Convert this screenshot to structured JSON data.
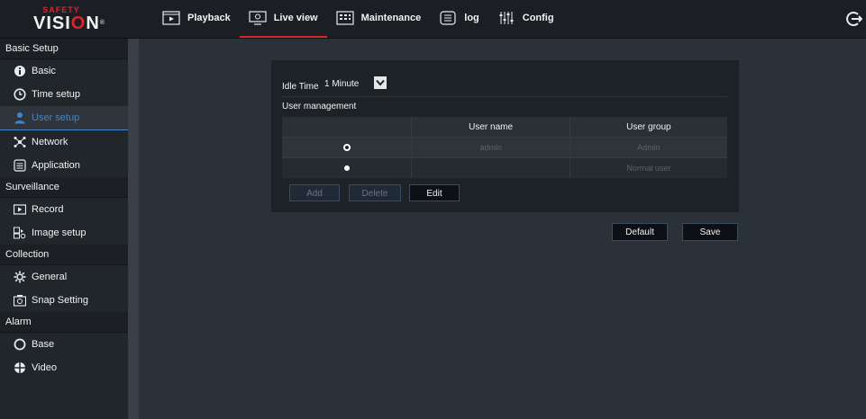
{
  "brand": {
    "top": "SAFETY",
    "main_pre": "VISI",
    "main_o": "O",
    "main_post": "N",
    "reg": "®"
  },
  "nav": {
    "items": [
      {
        "label": "Playback",
        "icon": "playback-icon"
      },
      {
        "label": "Live view",
        "icon": "live-view-icon",
        "active": true
      },
      {
        "label": "Maintenance",
        "icon": "maintenance-icon"
      },
      {
        "label": "log",
        "icon": "log-icon"
      },
      {
        "label": "Config",
        "icon": "config-icon"
      }
    ],
    "logout_icon": "logout-icon"
  },
  "sidebar": {
    "sections": [
      {
        "title": "Basic Setup",
        "items": [
          {
            "label": "Basic",
            "icon": "info-icon"
          },
          {
            "label": "Time setup",
            "icon": "clock-icon"
          },
          {
            "label": "User setup",
            "icon": "user-icon",
            "active": true
          },
          {
            "label": "Network",
            "icon": "network-icon"
          },
          {
            "label": "Application",
            "icon": "application-icon"
          }
        ]
      },
      {
        "title": "Surveillance",
        "items": [
          {
            "label": "Record",
            "icon": "record-icon"
          },
          {
            "label": "Image setup",
            "icon": "image-setup-icon"
          }
        ]
      },
      {
        "title": "Collection",
        "items": [
          {
            "label": "General",
            "icon": "gear-icon"
          },
          {
            "label": "Snap Setting",
            "icon": "camera-icon"
          }
        ]
      },
      {
        "title": "Alarm",
        "items": [
          {
            "label": "Base",
            "icon": "circle-icon"
          },
          {
            "label": "Video",
            "icon": "video-icon"
          }
        ]
      }
    ]
  },
  "panel": {
    "idle_label": "Idle Time",
    "idle_value": "1 Minute",
    "user_management_label": "User management",
    "table": {
      "headers": [
        "",
        "User name",
        "User group"
      ],
      "rows": [
        {
          "selected": true,
          "name": "admin",
          "group": "Admin"
        },
        {
          "selected": false,
          "name": "",
          "group": "Normal user"
        }
      ]
    },
    "buttons": {
      "add": "Add",
      "delete": "Delete",
      "edit": "Edit"
    }
  },
  "actions": {
    "default": "Default",
    "save": "Save"
  },
  "colors": {
    "accent_red": "#d9262b",
    "accent_blue": "#3f87c9",
    "background": "#2b3138"
  }
}
